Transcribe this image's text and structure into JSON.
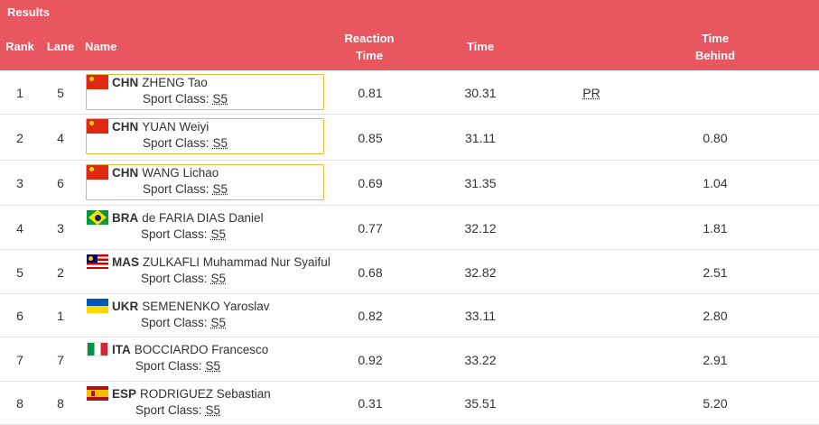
{
  "header": {
    "title": "Results",
    "columns": {
      "rank": "Rank",
      "lane": "Lane",
      "name": "Name",
      "reaction_line1": "Reaction",
      "reaction_line2": "Time",
      "time": "Time",
      "behind_line1": "Time",
      "behind_line2": "Behind"
    }
  },
  "sport_class_label": "Sport Class:",
  "rows": [
    {
      "rank": "1",
      "lane": "5",
      "flag": "chn-flag-icon",
      "noc": "CHN",
      "name": "ZHENG Tao",
      "sport_class": "S5",
      "reaction": "0.81",
      "time": "30.31",
      "record": "PR",
      "behind": "",
      "highlighted": true
    },
    {
      "rank": "2",
      "lane": "4",
      "flag": "chn-flag-icon",
      "noc": "CHN",
      "name": "YUAN Weiyi",
      "sport_class": "S5",
      "reaction": "0.85",
      "time": "31.11",
      "record": "",
      "behind": "0.80",
      "highlighted": true
    },
    {
      "rank": "3",
      "lane": "6",
      "flag": "chn-flag-icon",
      "noc": "CHN",
      "name": "WANG Lichao",
      "sport_class": "S5",
      "reaction": "0.69",
      "time": "31.35",
      "record": "",
      "behind": "1.04",
      "highlighted": true
    },
    {
      "rank": "4",
      "lane": "3",
      "flag": "bra-flag-icon",
      "noc": "BRA",
      "name": "de FARIA DIAS Daniel",
      "sport_class": "S5",
      "reaction": "0.77",
      "time": "32.12",
      "record": "",
      "behind": "1.81",
      "highlighted": false
    },
    {
      "rank": "5",
      "lane": "2",
      "flag": "mas-flag-icon",
      "noc": "MAS",
      "name": "ZULKAFLI Muhammad Nur Syaiful",
      "sport_class": "S5",
      "reaction": "0.68",
      "time": "32.82",
      "record": "",
      "behind": "2.51",
      "highlighted": false
    },
    {
      "rank": "6",
      "lane": "1",
      "flag": "ukr-flag-icon",
      "noc": "UKR",
      "name": "SEMENENKO Yaroslav",
      "sport_class": "S5",
      "reaction": "0.82",
      "time": "33.11",
      "record": "",
      "behind": "2.80",
      "highlighted": false
    },
    {
      "rank": "7",
      "lane": "7",
      "flag": "ita-flag-icon",
      "noc": "ITA",
      "name": "BOCCIARDO Francesco",
      "sport_class": "S5",
      "reaction": "0.92",
      "time": "33.22",
      "record": "",
      "behind": "2.91",
      "highlighted": false
    },
    {
      "rank": "8",
      "lane": "8",
      "flag": "esp-flag-icon",
      "noc": "ESP",
      "name": "RODRIGUEZ Sebastian",
      "sport_class": "S5",
      "reaction": "0.31",
      "time": "35.51",
      "record": "",
      "behind": "5.20",
      "highlighted": false
    }
  ],
  "colors": {
    "header_bg": "#e8565f",
    "medal_border": "#e5b93a"
  }
}
